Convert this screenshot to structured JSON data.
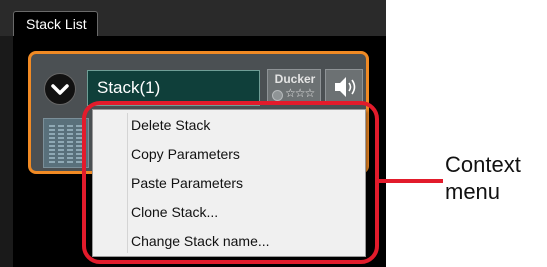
{
  "tab": {
    "label": "Stack List"
  },
  "stack": {
    "name": "Stack(1)",
    "ducker_label": "Ducker",
    "ducker_stars": "☆☆☆"
  },
  "context_menu": {
    "items": [
      {
        "label": "Delete Stack"
      },
      {
        "label": "Copy Parameters"
      },
      {
        "label": "Paste Parameters"
      },
      {
        "label": "Clone Stack..."
      },
      {
        "label": "Change Stack name..."
      }
    ]
  },
  "annotation": {
    "line1": "Context",
    "line2": "menu"
  },
  "colors": {
    "stack_border": "#f08a24",
    "highlight": "#e21b2b",
    "name_field_bg": "#0f3f3a"
  }
}
